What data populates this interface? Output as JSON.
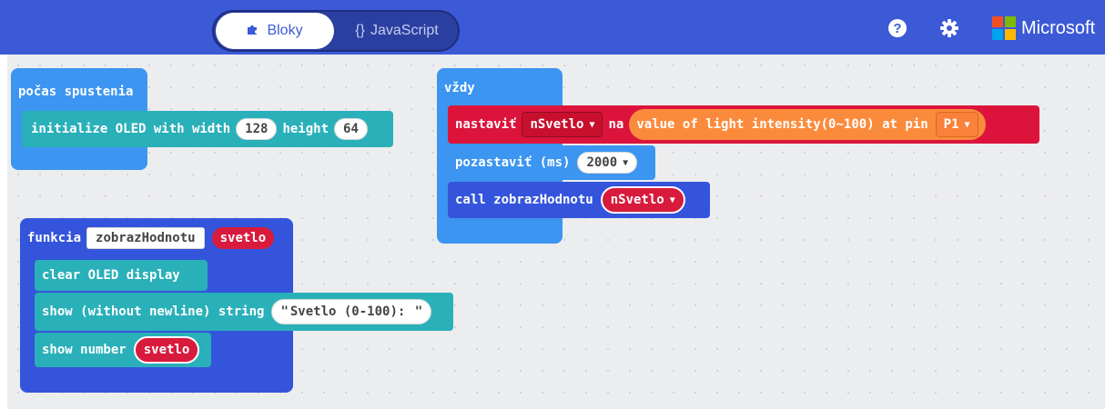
{
  "header": {
    "tab_blocks": "Bloky",
    "tab_js": "JavaScript",
    "tab_js_glyph": "{}",
    "brand": "Microsoft",
    "help_icon": "question-circle-icon",
    "settings_icon": "gear-icon",
    "colors": {
      "bar": "#3c5ad6",
      "toggle": "#2a3f9f"
    }
  },
  "blocks": {
    "on_start": {
      "label": "počas spustenia",
      "init_oled": {
        "prefix": "initialize OLED with width",
        "width": "128",
        "mid": "height",
        "height": "64"
      }
    },
    "forever": {
      "label": "vždy",
      "set": {
        "label": "nastaviť",
        "var": "nSvetlo",
        "na": "na",
        "expr": "value of light intensity(0~100) at pin",
        "pin": "P1"
      },
      "pause": {
        "label": "pozastaviť (ms)",
        "value": "2000"
      },
      "call": {
        "label": "call zobrazHodnotu",
        "arg": "nSvetlo"
      }
    },
    "function": {
      "label": "funkcia",
      "name": "zobrazHodnotu",
      "param": "svetlo",
      "clear": "clear OLED display",
      "show_string": {
        "label": "show (without newline) string",
        "value": "Svetlo (0-100): "
      },
      "show_number": {
        "label": "show number",
        "arg": "svetlo"
      }
    },
    "colors": {
      "events": "#3c95f0",
      "oled": "#2ab0b9",
      "variables": "#dc143c",
      "functions": "#3455db",
      "light": "#fb8b3c"
    }
  }
}
